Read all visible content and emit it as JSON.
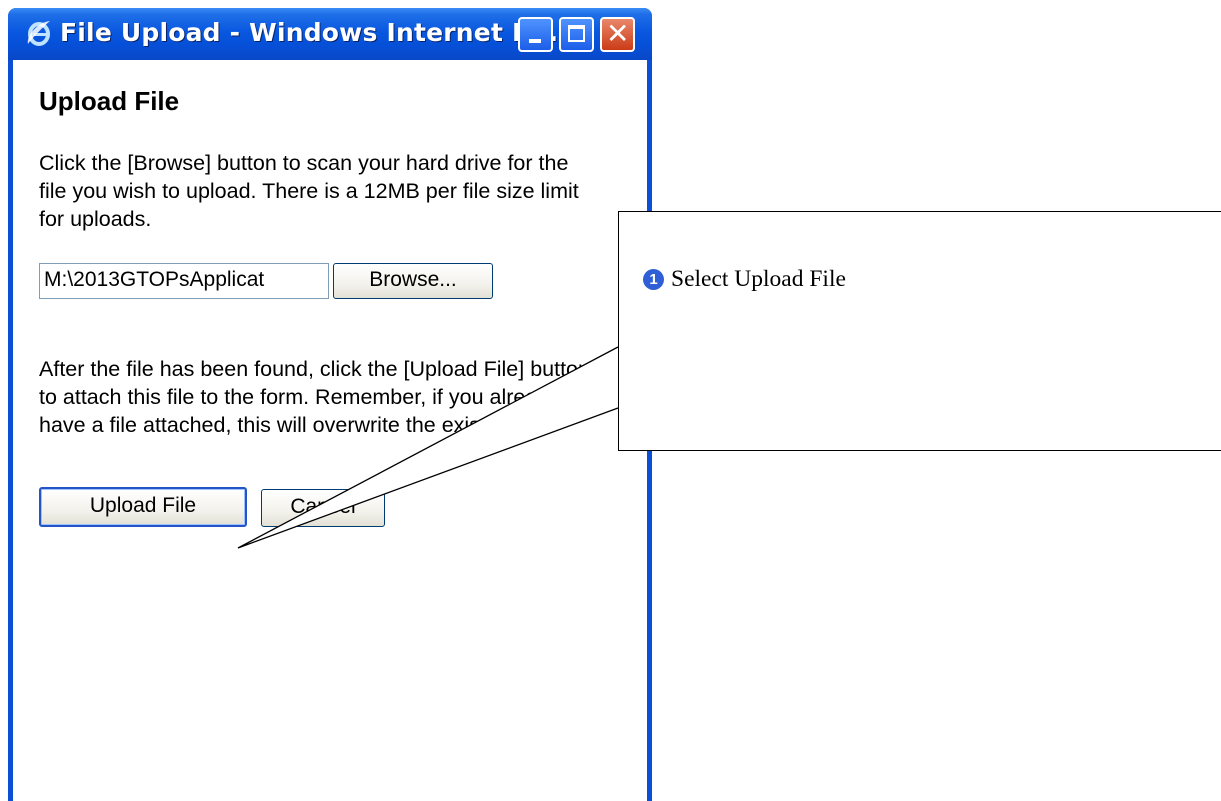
{
  "window": {
    "title": "File Upload - Windows Internet E...",
    "controls": {
      "minimize": "minimize",
      "maximize": "maximize",
      "close": "close"
    }
  },
  "page": {
    "heading": "Upload File",
    "instructions_1": "Click the [Browse] button to scan your hard drive for the file you wish to upload. There is a 12MB per file size limit for uploads.",
    "file_input_value": "M:\\2013GTOPsApplicat",
    "browse_label": "Browse...",
    "instructions_2": "After the file has been found, click the [Upload File] button to attach this file to the form. Remember, if you already have a file attached, this will overwrite the existing file.",
    "upload_label": "Upload File",
    "cancel_label": "Cancel"
  },
  "callout": {
    "number": "1",
    "text": "Select Upload File"
  },
  "colors": {
    "titlebar": "#0a58e0",
    "close_button": "#cb3b16",
    "callout_badge": "#2f5fd6"
  },
  "icons": {
    "title": "internet-explorer-icon"
  }
}
